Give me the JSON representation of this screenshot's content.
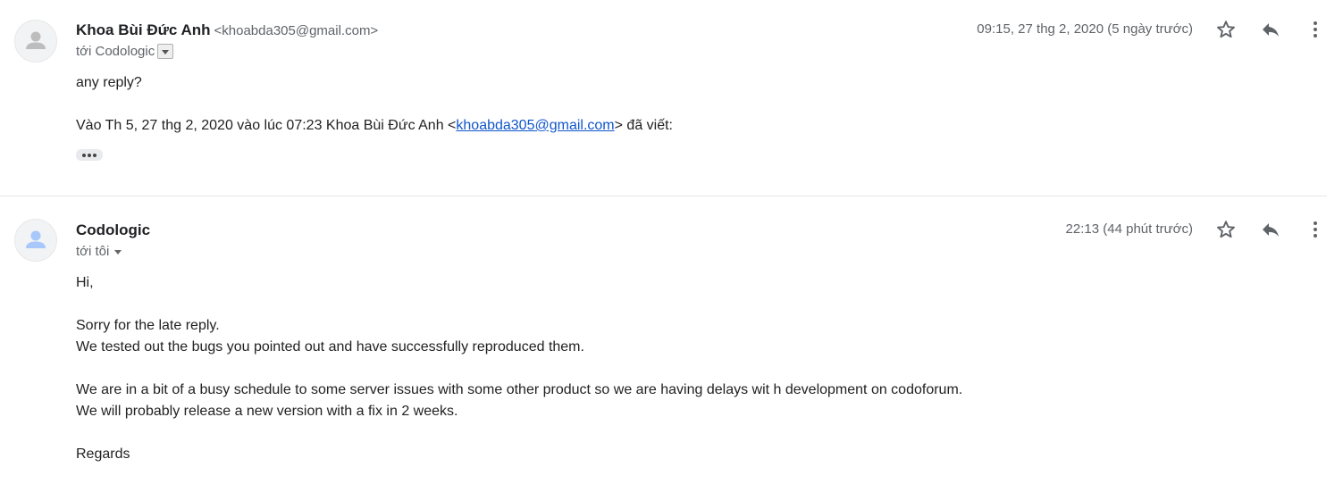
{
  "messages": [
    {
      "sender_name": "Khoa Bùi Đức Anh",
      "sender_email": "<khoabda305@gmail.com>",
      "to_line": "tới Codologic",
      "timestamp": "09:15, 27 thg 2, 2020 (5 ngày trước)",
      "avatar_color": "#bdbdbd",
      "body": {
        "line1": "any reply?",
        "quote_prefix": "Vào Th 5, 27 thg 2, 2020 vào lúc 07:23 Khoa Bùi Đức Anh <",
        "quote_link": "khoabda305@gmail.com",
        "quote_suffix": "> đã viết:"
      }
    },
    {
      "sender_name": "Codologic",
      "to_line": "tới tôi",
      "timestamp": "22:13 (44 phút trước)",
      "avatar_color": "#a8c7fa",
      "body": {
        "lines": [
          "Hi,",
          "",
          "Sorry for the late reply.",
          "We tested out the bugs you pointed out and have successfully reproduced them.",
          "",
          "We are in a bit of a busy schedule to some server issues with some other product so we are having delays wit h development on codoforum.",
          "We will probably release a new version with a fix in 2 weeks.",
          "",
          "Regards"
        ]
      }
    }
  ],
  "icons": {
    "star": "star-icon",
    "reply": "reply-icon",
    "more": "more-vert-icon",
    "avatar": "person-icon",
    "expand": "chevron-down-icon",
    "trimmed": "ellipsis-icon"
  },
  "colors": {
    "link": "#1155cc",
    "secondary_text": "#5f6368",
    "divider": "#e6e6e6"
  }
}
